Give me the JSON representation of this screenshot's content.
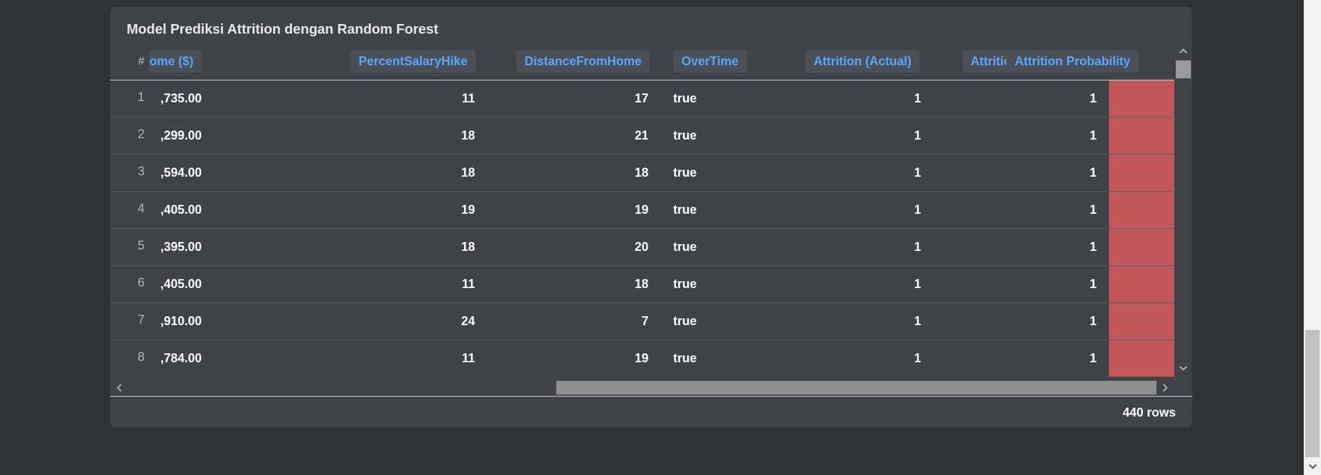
{
  "title": "Model Prediksi Attrition dengan Random Forest",
  "columns": {
    "rownum": "#",
    "income": "ome ($)",
    "salary_hike": "PercentSalaryHike",
    "distance": "DistanceFromHome",
    "overtime": "OverTime",
    "actual": "Attrition (Actual)",
    "predicted": "Attrition (Predicted)",
    "probability": "Attrition Probability"
  },
  "rows": [
    {
      "n": "1",
      "income": ",735.00",
      "hike": "11",
      "distance": "17",
      "overtime": "true",
      "actual": "1",
      "predicted": "1",
      "prob": "99.1%"
    },
    {
      "n": "2",
      "income": ",299.00",
      "hike": "18",
      "distance": "21",
      "overtime": "true",
      "actual": "1",
      "predicted": "1",
      "prob": "99%"
    },
    {
      "n": "3",
      "income": ",594.00",
      "hike": "18",
      "distance": "18",
      "overtime": "true",
      "actual": "1",
      "predicted": "1",
      "prob": "98.7%"
    },
    {
      "n": "4",
      "income": ",405.00",
      "hike": "19",
      "distance": "19",
      "overtime": "true",
      "actual": "1",
      "predicted": "1",
      "prob": "98.6%"
    },
    {
      "n": "5",
      "income": ",395.00",
      "hike": "18",
      "distance": "20",
      "overtime": "true",
      "actual": "1",
      "predicted": "1",
      "prob": "98%"
    },
    {
      "n": "6",
      "income": ",405.00",
      "hike": "11",
      "distance": "18",
      "overtime": "true",
      "actual": "1",
      "predicted": "1",
      "prob": "98%"
    },
    {
      "n": "7",
      "income": ",910.00",
      "hike": "24",
      "distance": "7",
      "overtime": "true",
      "actual": "1",
      "predicted": "1",
      "prob": "97.9%"
    },
    {
      "n": "8",
      "income": ",784.00",
      "hike": "11",
      "distance": "19",
      "overtime": "true",
      "actual": "1",
      "predicted": "1",
      "prob": "97.9%"
    }
  ],
  "footer": {
    "row_count": "440 rows"
  },
  "colors": {
    "accent": "#57a5ff",
    "highlight": "#c05758",
    "background": "#2f3237",
    "card": "#3f4247"
  },
  "icons": {
    "up": "chevron-up-icon",
    "down": "chevron-down-icon",
    "left": "chevron-left-icon",
    "right": "chevron-right-icon"
  }
}
